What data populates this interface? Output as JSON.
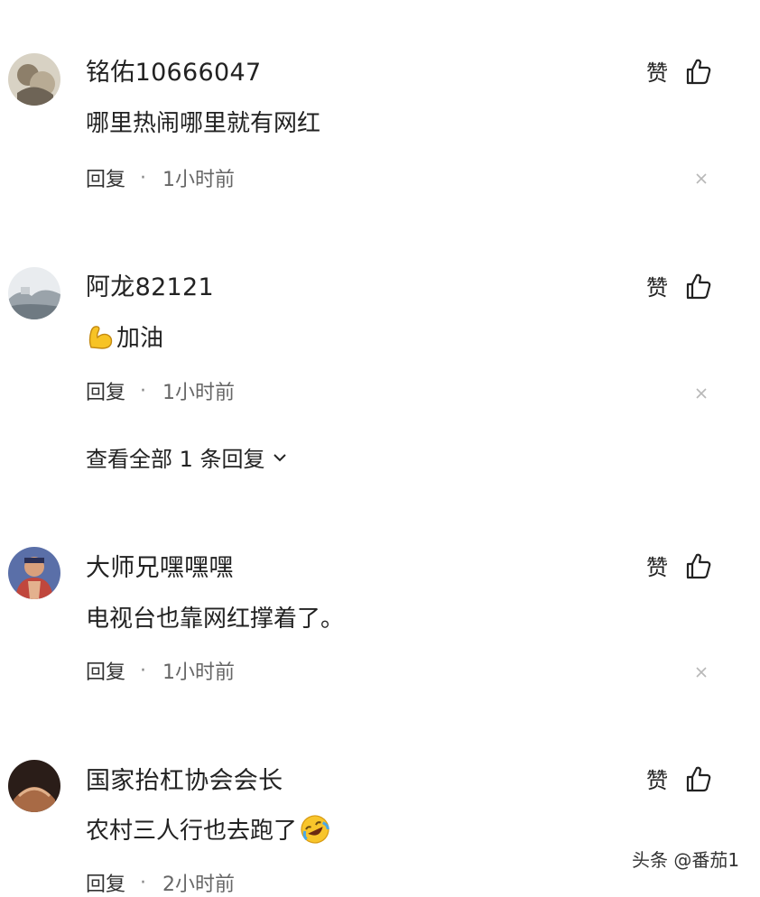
{
  "like_label": "赞",
  "reply_label": "回复",
  "dot": "·",
  "comments": [
    {
      "username": "铭佑10666047",
      "content": "哪里热闹哪里就有网红",
      "time": "1小时前"
    },
    {
      "username": "阿龙82121",
      "content_emoji": "flexed-biceps-emoji",
      "content": "加油",
      "time": "1小时前",
      "view_replies": "查看全部 1 条回复"
    },
    {
      "username": "大师兄嘿嘿嘿",
      "content": "电视台也靠网红撑着了。",
      "time": "1小时前"
    },
    {
      "username": "国家抬杠协会会长",
      "content": "农村三人行也去跑了",
      "content_emoji": "rolling-laughing-emoji",
      "time": "2小时前"
    }
  ],
  "watermark": "头条 @番茄1"
}
